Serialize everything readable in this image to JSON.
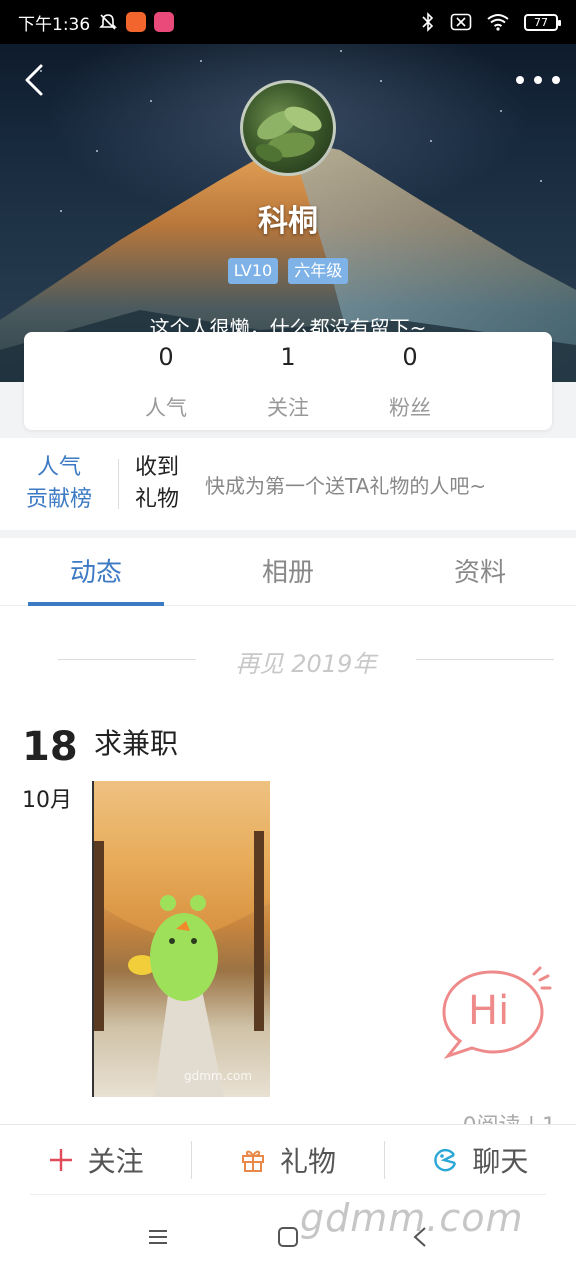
{
  "status_bar": {
    "time": "下午1:36",
    "battery": "77"
  },
  "profile": {
    "name": "科桐",
    "level_badge": "LV10",
    "grade_badge": "六年级",
    "bio": "这个人很懒，什么都没有留下~"
  },
  "stats": [
    {
      "value": "0",
      "label": "人气"
    },
    {
      "value": "1",
      "label": "关注"
    },
    {
      "value": "0",
      "label": "粉丝"
    }
  ],
  "gifts": {
    "rank_line1": "人气",
    "rank_line2": "贡献榜",
    "received_line1": "收到",
    "received_line2": "礼物",
    "hint": "快成为第一个送TA礼物的人吧~"
  },
  "tabs": [
    "动态",
    "相册",
    "资料"
  ],
  "active_tab": "动态",
  "feed": {
    "year_separator": "再见 2019年",
    "post": {
      "day": "18",
      "month": "10月",
      "title": "求兼职",
      "image_watermark": "gdmm.com",
      "meta": "0阅读  |  1"
    }
  },
  "hi_bubble": "Hi",
  "actions": {
    "follow": "关注",
    "gift": "礼物",
    "chat": "聊天"
  },
  "site_watermark": "gdmm.com",
  "colors": {
    "accent": "#3d7ac4",
    "badge": "#7fb3e8",
    "follow_icon": "#e04a5a",
    "gift_icon": "#e8894a",
    "chat_icon": "#2aa7d6",
    "hi": "#ef8a8a"
  }
}
